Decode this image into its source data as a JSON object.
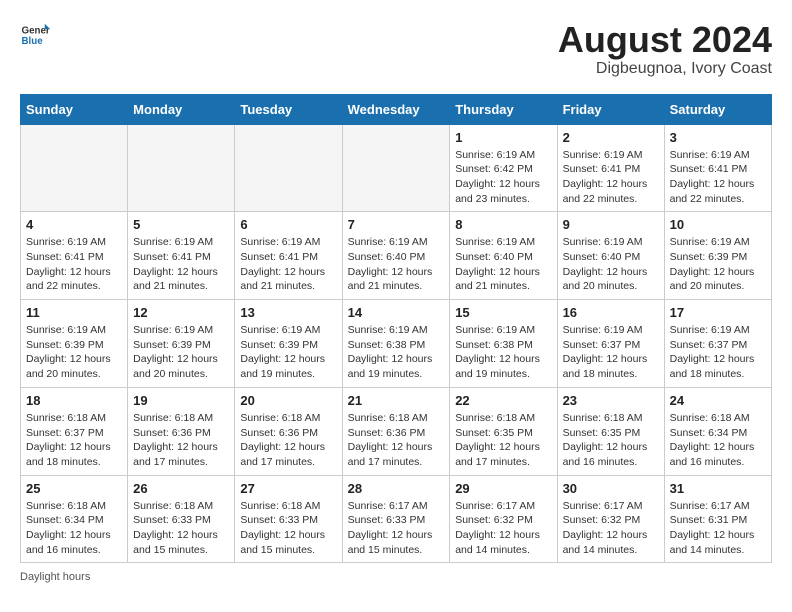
{
  "logo": {
    "line1": "General",
    "line2": "Blue"
  },
  "title": "August 2024",
  "subtitle": "Digbeugnoa, Ivory Coast",
  "weekdays": [
    "Sunday",
    "Monday",
    "Tuesday",
    "Wednesday",
    "Thursday",
    "Friday",
    "Saturday"
  ],
  "footer": "Daylight hours",
  "weeks": [
    [
      {
        "day": "",
        "detail": ""
      },
      {
        "day": "",
        "detail": ""
      },
      {
        "day": "",
        "detail": ""
      },
      {
        "day": "",
        "detail": ""
      },
      {
        "day": "1",
        "detail": "Sunrise: 6:19 AM\nSunset: 6:42 PM\nDaylight: 12 hours and 23 minutes."
      },
      {
        "day": "2",
        "detail": "Sunrise: 6:19 AM\nSunset: 6:41 PM\nDaylight: 12 hours and 22 minutes."
      },
      {
        "day": "3",
        "detail": "Sunrise: 6:19 AM\nSunset: 6:41 PM\nDaylight: 12 hours and 22 minutes."
      }
    ],
    [
      {
        "day": "4",
        "detail": "Sunrise: 6:19 AM\nSunset: 6:41 PM\nDaylight: 12 hours and 22 minutes."
      },
      {
        "day": "5",
        "detail": "Sunrise: 6:19 AM\nSunset: 6:41 PM\nDaylight: 12 hours and 21 minutes."
      },
      {
        "day": "6",
        "detail": "Sunrise: 6:19 AM\nSunset: 6:41 PM\nDaylight: 12 hours and 21 minutes."
      },
      {
        "day": "7",
        "detail": "Sunrise: 6:19 AM\nSunset: 6:40 PM\nDaylight: 12 hours and 21 minutes."
      },
      {
        "day": "8",
        "detail": "Sunrise: 6:19 AM\nSunset: 6:40 PM\nDaylight: 12 hours and 21 minutes."
      },
      {
        "day": "9",
        "detail": "Sunrise: 6:19 AM\nSunset: 6:40 PM\nDaylight: 12 hours and 20 minutes."
      },
      {
        "day": "10",
        "detail": "Sunrise: 6:19 AM\nSunset: 6:39 PM\nDaylight: 12 hours and 20 minutes."
      }
    ],
    [
      {
        "day": "11",
        "detail": "Sunrise: 6:19 AM\nSunset: 6:39 PM\nDaylight: 12 hours and 20 minutes."
      },
      {
        "day": "12",
        "detail": "Sunrise: 6:19 AM\nSunset: 6:39 PM\nDaylight: 12 hours and 20 minutes."
      },
      {
        "day": "13",
        "detail": "Sunrise: 6:19 AM\nSunset: 6:39 PM\nDaylight: 12 hours and 19 minutes."
      },
      {
        "day": "14",
        "detail": "Sunrise: 6:19 AM\nSunset: 6:38 PM\nDaylight: 12 hours and 19 minutes."
      },
      {
        "day": "15",
        "detail": "Sunrise: 6:19 AM\nSunset: 6:38 PM\nDaylight: 12 hours and 19 minutes."
      },
      {
        "day": "16",
        "detail": "Sunrise: 6:19 AM\nSunset: 6:37 PM\nDaylight: 12 hours and 18 minutes."
      },
      {
        "day": "17",
        "detail": "Sunrise: 6:19 AM\nSunset: 6:37 PM\nDaylight: 12 hours and 18 minutes."
      }
    ],
    [
      {
        "day": "18",
        "detail": "Sunrise: 6:18 AM\nSunset: 6:37 PM\nDaylight: 12 hours and 18 minutes."
      },
      {
        "day": "19",
        "detail": "Sunrise: 6:18 AM\nSunset: 6:36 PM\nDaylight: 12 hours and 17 minutes."
      },
      {
        "day": "20",
        "detail": "Sunrise: 6:18 AM\nSunset: 6:36 PM\nDaylight: 12 hours and 17 minutes."
      },
      {
        "day": "21",
        "detail": "Sunrise: 6:18 AM\nSunset: 6:36 PM\nDaylight: 12 hours and 17 minutes."
      },
      {
        "day": "22",
        "detail": "Sunrise: 6:18 AM\nSunset: 6:35 PM\nDaylight: 12 hours and 17 minutes."
      },
      {
        "day": "23",
        "detail": "Sunrise: 6:18 AM\nSunset: 6:35 PM\nDaylight: 12 hours and 16 minutes."
      },
      {
        "day": "24",
        "detail": "Sunrise: 6:18 AM\nSunset: 6:34 PM\nDaylight: 12 hours and 16 minutes."
      }
    ],
    [
      {
        "day": "25",
        "detail": "Sunrise: 6:18 AM\nSunset: 6:34 PM\nDaylight: 12 hours and 16 minutes."
      },
      {
        "day": "26",
        "detail": "Sunrise: 6:18 AM\nSunset: 6:33 PM\nDaylight: 12 hours and 15 minutes."
      },
      {
        "day": "27",
        "detail": "Sunrise: 6:18 AM\nSunset: 6:33 PM\nDaylight: 12 hours and 15 minutes."
      },
      {
        "day": "28",
        "detail": "Sunrise: 6:17 AM\nSunset: 6:33 PM\nDaylight: 12 hours and 15 minutes."
      },
      {
        "day": "29",
        "detail": "Sunrise: 6:17 AM\nSunset: 6:32 PM\nDaylight: 12 hours and 14 minutes."
      },
      {
        "day": "30",
        "detail": "Sunrise: 6:17 AM\nSunset: 6:32 PM\nDaylight: 12 hours and 14 minutes."
      },
      {
        "day": "31",
        "detail": "Sunrise: 6:17 AM\nSunset: 6:31 PM\nDaylight: 12 hours and 14 minutes."
      }
    ]
  ]
}
